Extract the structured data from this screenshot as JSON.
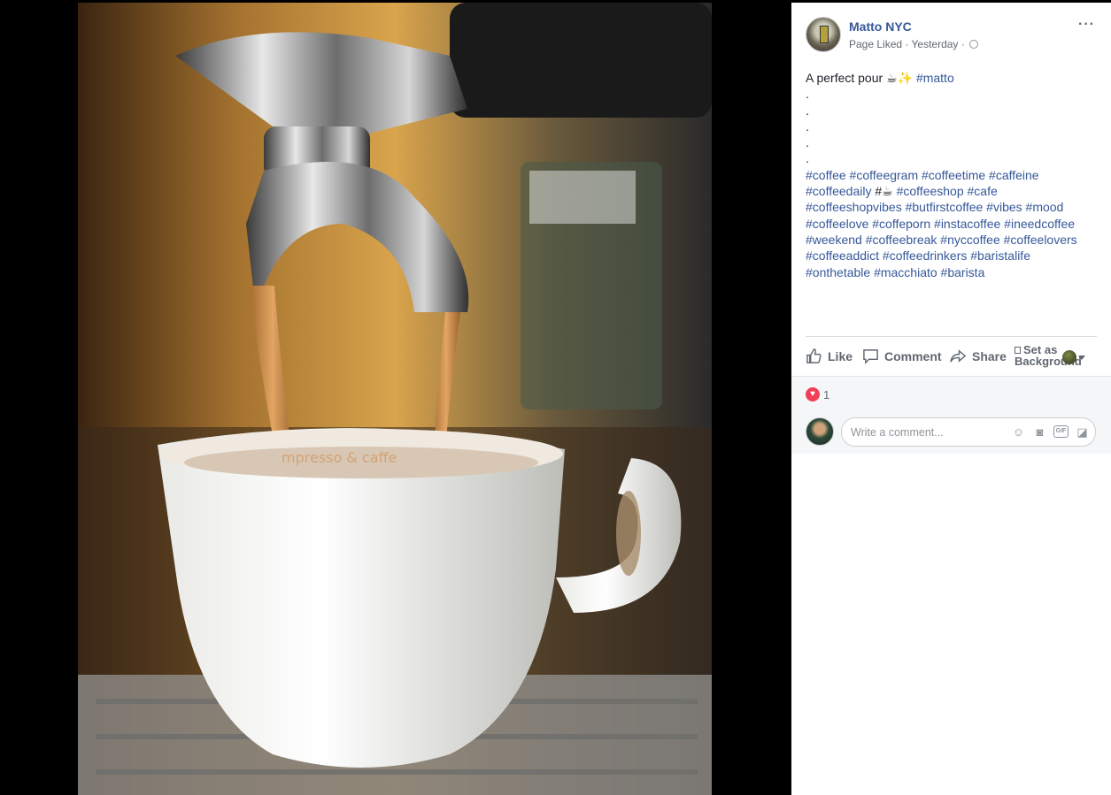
{
  "post": {
    "page_name": "Matto NYC",
    "meta": "Page Liked · Yesterday ·",
    "more_label": "···",
    "caption_text": "A perfect pour ☕✨",
    "caption_hashtag": "#matto",
    "dots": [
      ".",
      ".",
      ".",
      ".",
      "."
    ],
    "hashtags_1": "#coffee #coffeegram #coffeetime #caffeine",
    "hashtags_2a": "#coffeedaily",
    "hashtags_2b": "#☕",
    "hashtags_2c": "#coffeeshop #cafe",
    "hashtags_3": "#coffeeshopvibes #butfirstcoffee #vibes #mood",
    "hashtags_4": "#coffeelove #coffeporn #instacoffee #ineedcoffee",
    "hashtags_5": "#weekend #coffeebreak #nyccoffee #coffeelovers",
    "hashtags_6": "#coffeeaddict #coffeedrinkers #baristalife",
    "hashtags_7": "#onthetable #macchiato #barista"
  },
  "actions": {
    "like": "Like",
    "comment": "Comment",
    "share": "Share",
    "set_as_1": "Set as",
    "set_as_2": "Background"
  },
  "reactions": {
    "count": "1",
    "type": "love"
  },
  "comment_box": {
    "placeholder": "Write a comment..."
  },
  "colors": {
    "link": "#365899",
    "panel_bg": "#ffffff",
    "comment_area_bg": "#f5f6f7",
    "love": "#f33e58"
  },
  "icons": [
    "thumbs-up-icon",
    "comment-bubble-icon",
    "share-arrow-icon",
    "emoji-icon",
    "camera-icon",
    "gif-icon",
    "sticker-icon",
    "globe-icon"
  ]
}
